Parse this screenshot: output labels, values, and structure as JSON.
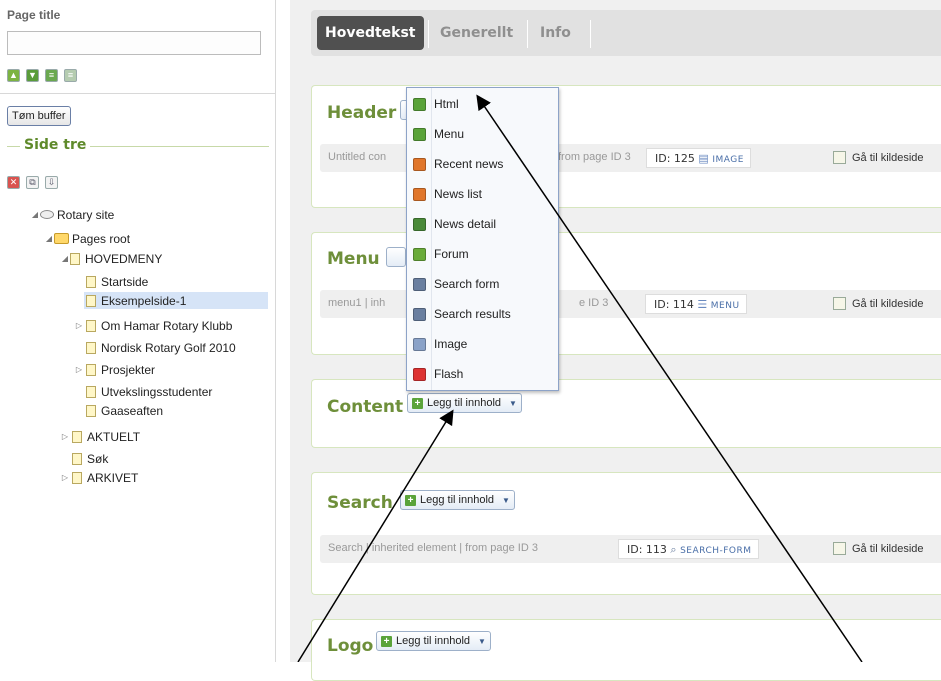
{
  "left_panel": {
    "page_title_label": "Page title",
    "page_title_value": "",
    "tom_buffer_label": "Tøm buffer",
    "side_tre_label": "Side tre",
    "tree": [
      {
        "label": "Rotary site",
        "arrow": "◢"
      },
      {
        "label": "Pages root",
        "arrow": "◢"
      },
      {
        "label": "HOVEDMENY",
        "arrow": "◢"
      },
      {
        "label": "Startside",
        "arrow": ""
      },
      {
        "label": "Eksempelside-1",
        "arrow": "",
        "selected": true
      },
      {
        "label": "Om Hamar Rotary Klubb",
        "arrow": "▷"
      },
      {
        "label": "Nordisk Rotary Golf 2010",
        "arrow": ""
      },
      {
        "label": "Prosjekter",
        "arrow": "▷"
      },
      {
        "label": "Utvekslingsstudenter",
        "arrow": ""
      },
      {
        "label": "Gaaseaften",
        "arrow": ""
      },
      {
        "label": "AKTUELT",
        "arrow": "▷"
      },
      {
        "label": "Søk",
        "arrow": ""
      },
      {
        "label": "ARKIVET",
        "arrow": "▷"
      }
    ]
  },
  "tabs": [
    "Hovedtekst",
    "Generellt",
    "Info"
  ],
  "add_content_label": "Legg til innhold",
  "goto_source_label": "Gå til kildeside",
  "sections": [
    {
      "title": "Header",
      "inherited": "Untitled con",
      "inherited_tail": "from page ID 3",
      "id_text": "ID: 125",
      "type": "IMAGE"
    },
    {
      "title": "Menu",
      "inherited": "menu1 | inh",
      "inherited_tail": "e ID 3",
      "id_text": "ID: 114",
      "type": "MENU"
    },
    {
      "title": "Content"
    },
    {
      "title": "Search",
      "inherited": "Search | inherited element | from page ID 3",
      "id_text": "ID: 113",
      "type": "SEARCH-FORM"
    },
    {
      "title": "Logo"
    }
  ],
  "dropdown_items": [
    {
      "label": "Html",
      "icon": "html-icon",
      "color": "#5aa33a"
    },
    {
      "label": "Menu",
      "icon": "menu-icon",
      "color": "#5aa33a"
    },
    {
      "label": "Recent news",
      "icon": "recent-news-icon",
      "color": "#e0762b"
    },
    {
      "label": "News list",
      "icon": "news-list-icon",
      "color": "#e0762b"
    },
    {
      "label": "News detail",
      "icon": "news-detail-icon",
      "color": "#4a8a3a"
    },
    {
      "label": "Forum",
      "icon": "forum-icon",
      "color": "#6aab3a"
    },
    {
      "label": "Search form",
      "icon": "search-icon",
      "color": "#6a7fa0"
    },
    {
      "label": "Search results",
      "icon": "search-results-icon",
      "color": "#6a7fa0"
    },
    {
      "label": "Image",
      "icon": "image-icon",
      "color": "#8aa2c8"
    },
    {
      "label": "Flash",
      "icon": "flash-icon",
      "color": "#d33"
    }
  ],
  "colors": {
    "accent_green": "#6e8f3a",
    "tab_active": "#505050",
    "selection": "#d6e4f7"
  }
}
